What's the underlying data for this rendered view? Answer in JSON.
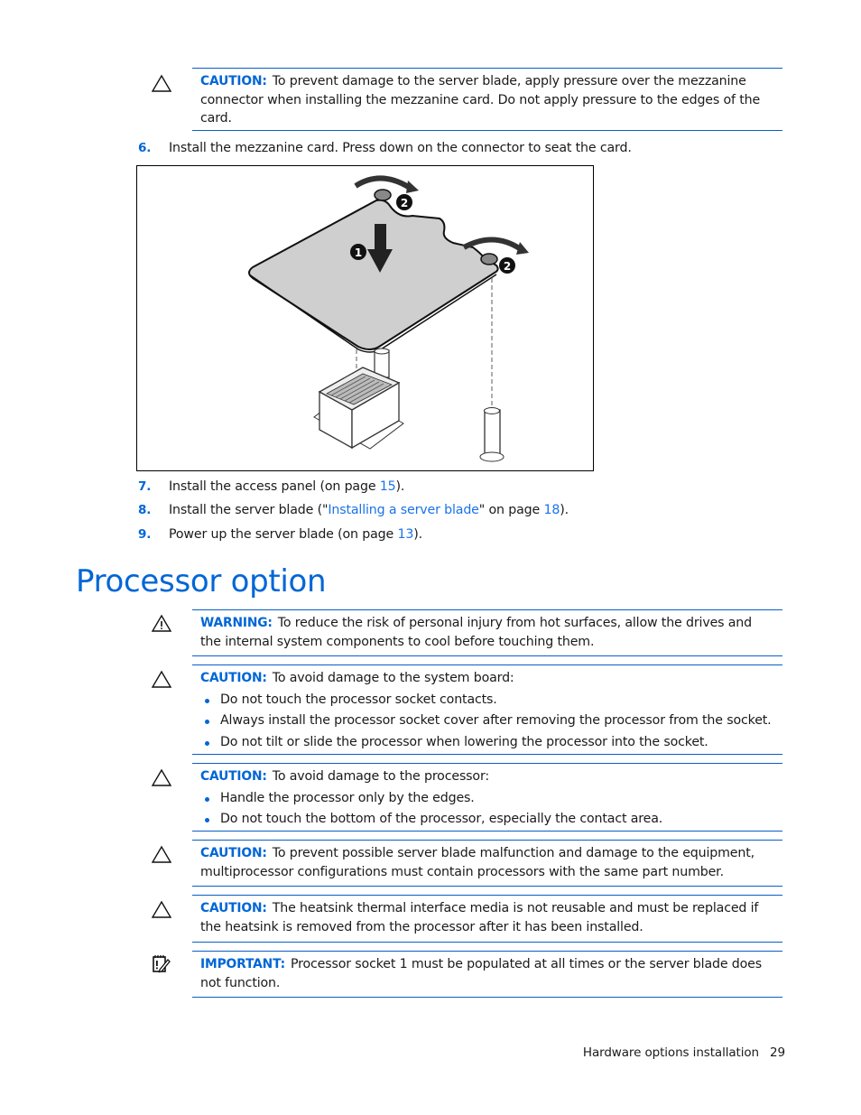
{
  "top_caution": {
    "label": "CAUTION:",
    "text": "To prevent damage to the server blade, apply pressure over the mezzanine connector when installing the mezzanine card. Do not apply pressure to the edges of the card."
  },
  "steps_before_figure": [
    {
      "num": "6.",
      "text": "Install the mezzanine card. Press down on the connector to seat the card."
    }
  ],
  "figure": {
    "alt": "Mezzanine card installation illustration",
    "callouts": [
      "1",
      "2",
      "2"
    ]
  },
  "steps_after_figure": [
    {
      "num": "7.",
      "pre": "Install the access panel (on page ",
      "link1": "15",
      "post": ")."
    },
    {
      "num": "8.",
      "pre": "Install the server blade (\"",
      "link_text": "Installing a server blade",
      "mid": "\" on page ",
      "link1": "18",
      "post": ")."
    },
    {
      "num": "9.",
      "pre": "Power up the server blade (on page ",
      "link1": "13",
      "post": ")."
    }
  ],
  "section": {
    "title": "Processor option"
  },
  "notices": [
    {
      "type": "warning",
      "icon": "warning-triangle-icon",
      "label": "WARNING:",
      "text": "To reduce the risk of personal injury from hot surfaces, allow the drives and the internal system components to cool before touching them."
    },
    {
      "type": "caution",
      "icon": "caution-triangle-icon",
      "label": "CAUTION:",
      "text": "To avoid damage to the system board:",
      "bullets": [
        "Do not touch the processor socket contacts.",
        "Always install the processor socket cover after removing the processor from the socket.",
        "Do not tilt or slide the processor when lowering the processor into the socket."
      ]
    },
    {
      "type": "caution",
      "icon": "caution-triangle-icon",
      "label": "CAUTION:",
      "text": "To avoid damage to the processor:",
      "bullets": [
        "Handle the processor only by the edges.",
        "Do not touch the bottom of the processor, especially the contact area."
      ]
    },
    {
      "type": "caution",
      "icon": "caution-triangle-icon",
      "label": "CAUTION:",
      "text": "To prevent possible server blade malfunction and damage to the equipment, multiprocessor configurations must contain processors with the same part number."
    },
    {
      "type": "caution",
      "icon": "caution-triangle-icon",
      "label": "CAUTION:",
      "text": "The heatsink thermal interface media is not reusable and must be replaced if the heatsink is removed from the processor after it has been installed."
    },
    {
      "type": "important",
      "icon": "important-notepad-icon",
      "label": "IMPORTANT:",
      "text": "Processor socket 1 must be populated at all times or the server blade does not function."
    }
  ],
  "footer": {
    "section_name": "Hardware options installation",
    "page_number": "29"
  },
  "colors": {
    "accent": "#0066d6",
    "rule": "#0a5fc4",
    "text": "#1a1a1a"
  }
}
